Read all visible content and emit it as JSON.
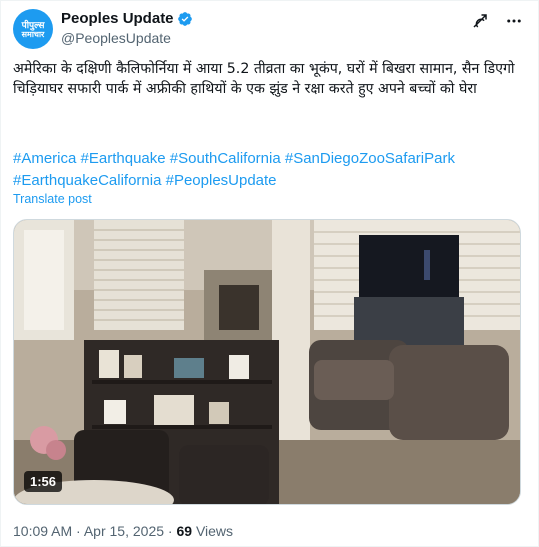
{
  "account": {
    "avatar_line1": "पीपुल्स",
    "avatar_line2": "समाचार",
    "display_name": "Peoples Update",
    "handle": "@PeoplesUpdate",
    "verified_icon": "verified-badge-icon"
  },
  "post": {
    "text": "अमेरिका के दक्षिणी कैलिफोर्निया में आया 5.2 तीव्रता का भूकंप, घरों में बिखरा सामान, सैन डिएगो चिड़ियाघर सफारी पार्क में अफ्रीकी हाथियों के एक झुंड ने रक्षा करते हुए अपने बच्चों को घेरा",
    "hashtags": [
      "#America",
      "#Earthquake",
      "#SouthCalifornia",
      "#SanDiegoZooSafariPark",
      "#EarthquakeCalifornia",
      "#PeoplesUpdate"
    ],
    "translate_label": "Translate post"
  },
  "video": {
    "duration": "1:56"
  },
  "meta": {
    "time": "10:09 AM",
    "separator": "·",
    "date": "Apr 15, 2025",
    "views_count": "69",
    "views_label": "Views"
  },
  "colors": {
    "accent": "#1d9bf0",
    "secondary_text": "#536471",
    "primary_text": "#0f1419"
  },
  "icons": [
    "grok-icon",
    "more-icon"
  ]
}
